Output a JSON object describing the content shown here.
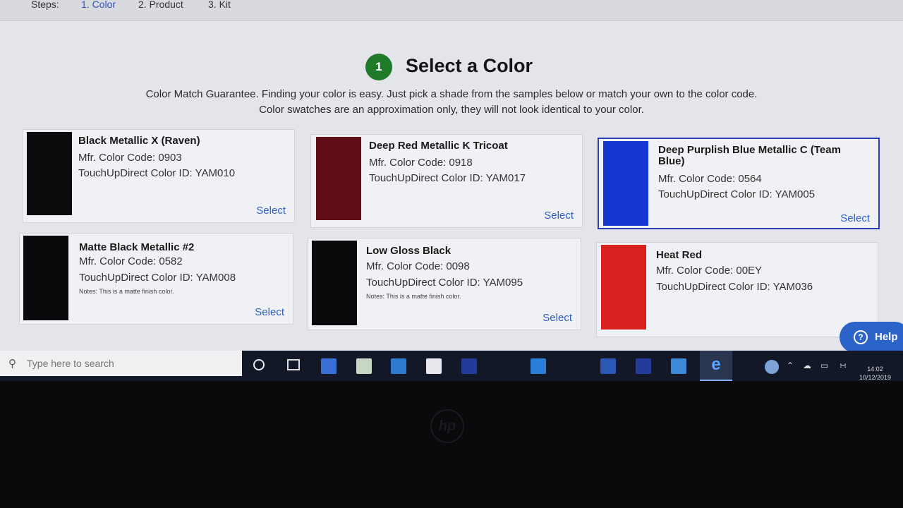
{
  "steps": {
    "label": "Steps:",
    "items": [
      "1. Color",
      "2. Product",
      "3. Kit"
    ]
  },
  "heading": {
    "step_number": "1",
    "title": "Select a Color"
  },
  "description": {
    "line1": "Color Match Guarantee. Finding your color is easy. Just pick a shade from the samples below or match your own to the color code.",
    "line2": "Color swatches are an approximation only, they will not look identical to your color."
  },
  "colors": [
    {
      "name": "Black Metallic X (Raven)",
      "code": "Mfr. Color Code: 0903",
      "id": "TouchUpDirect Color ID: YAM010",
      "note": "",
      "select": "Select",
      "swatch": "#0b0b0d"
    },
    {
      "name": "Deep Red Metallic K Tricoat",
      "code": "Mfr. Color Code: 0918",
      "id": "TouchUpDirect Color ID: YAM017",
      "note": "",
      "select": "Select",
      "swatch": "#5e0d16"
    },
    {
      "name": "Deep Purplish Blue Metallic C (Team Blue)",
      "code": "Mfr. Color Code: 0564",
      "id": "TouchUpDirect Color ID: YAM005",
      "note": "",
      "select": "Select",
      "swatch": "#1637d4"
    },
    {
      "name": "Matte Black Metallic #2",
      "code": "Mfr. Color Code: 0582",
      "id": "TouchUpDirect Color ID: YAM008",
      "note": "Notes: This is a matte finish color.",
      "select": "Select",
      "swatch": "#0a0a0c"
    },
    {
      "name": "Low Gloss Black",
      "code": "Mfr. Color Code: 0098",
      "id": "TouchUpDirect Color ID: YAM095",
      "note": "Notes: This is a matte finish color.",
      "select": "Select",
      "swatch": "#0a0a0c"
    },
    {
      "name": "Heat Red",
      "code": "Mfr. Color Code: 00EY",
      "id": "TouchUpDirect Color ID: YAM036",
      "note": "",
      "select": "",
      "swatch": "#d8201f"
    }
  ],
  "help": {
    "label": "Help",
    "icon": "?"
  },
  "taskbar": {
    "search_placeholder": "Type here to search",
    "clock_time": "14:02",
    "clock_date": "10/12/2019"
  },
  "bezel_logo": "hp"
}
